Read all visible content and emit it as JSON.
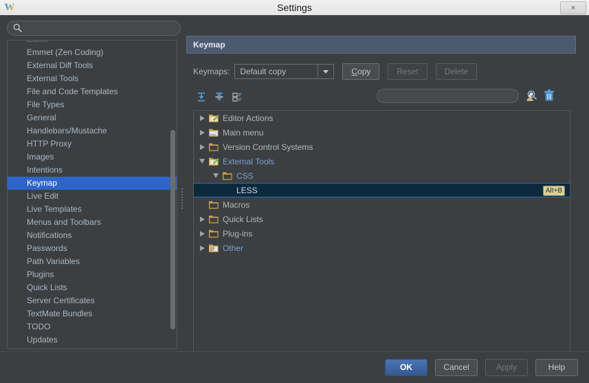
{
  "window": {
    "title": "Settings",
    "app_icon": "webstorm-logo-icon",
    "close_label": "×"
  },
  "sidebar": {
    "search": {
      "value": "",
      "placeholder": ""
    },
    "clipped_top_item": "Editor",
    "items": [
      {
        "label": "Emmet (Zen Coding)",
        "selected": false
      },
      {
        "label": "External Diff Tools",
        "selected": false
      },
      {
        "label": "External Tools",
        "selected": false
      },
      {
        "label": "File and Code Templates",
        "selected": false
      },
      {
        "label": "File Types",
        "selected": false
      },
      {
        "label": "General",
        "selected": false
      },
      {
        "label": "Handlebars/Mustache",
        "selected": false
      },
      {
        "label": "HTTP Proxy",
        "selected": false
      },
      {
        "label": "Images",
        "selected": false
      },
      {
        "label": "Intentions",
        "selected": false
      },
      {
        "label": "Keymap",
        "selected": true
      },
      {
        "label": "Live Edit",
        "selected": false
      },
      {
        "label": "Live Templates",
        "selected": false
      },
      {
        "label": "Menus and Toolbars",
        "selected": false
      },
      {
        "label": "Notifications",
        "selected": false
      },
      {
        "label": "Passwords",
        "selected": false
      },
      {
        "label": "Path Variables",
        "selected": false
      },
      {
        "label": "Plugins",
        "selected": false
      },
      {
        "label": "Quick Lists",
        "selected": false
      },
      {
        "label": "Server Certificates",
        "selected": false
      },
      {
        "label": "TextMate Bundles",
        "selected": false
      },
      {
        "label": "TODO",
        "selected": false
      },
      {
        "label": "Updates",
        "selected": false
      }
    ]
  },
  "panel": {
    "title": "Keymap",
    "keymaps_label": "Keymaps:",
    "keymap_selected": "Default copy",
    "buttons": {
      "copy": "Copy",
      "copy_mnemonic": "C",
      "copy_rest": "opy",
      "reset": "Reset",
      "delete": "Delete"
    },
    "toolbar": {
      "expand_all": "expand-all-icon",
      "collapse_all": "collapse-all-icon",
      "edit_shortcut": "edit-shortcut-icon",
      "search_value": "",
      "search_placeholder": "",
      "find_by_shortcut": "find-by-shortcut-icon",
      "clear": "trash-icon"
    }
  },
  "tree": {
    "nodes": [
      {
        "label": "Editor Actions",
        "indent": 0,
        "twist": "right",
        "icon": "folder-edit-icon",
        "style": "normal",
        "selected": false,
        "shortcut": ""
      },
      {
        "label": "Main menu",
        "indent": 0,
        "twist": "right",
        "icon": "folder-menu-icon",
        "style": "normal",
        "selected": false,
        "shortcut": ""
      },
      {
        "label": "Version Control Systems",
        "indent": 0,
        "twist": "right",
        "icon": "folder-icon",
        "style": "normal",
        "selected": false,
        "shortcut": ""
      },
      {
        "label": "External Tools",
        "indent": 0,
        "twist": "down",
        "icon": "folder-edit-icon",
        "style": "blue",
        "selected": false,
        "shortcut": ""
      },
      {
        "label": "CSS",
        "indent": 1,
        "twist": "down",
        "icon": "folder-icon",
        "style": "blue",
        "selected": false,
        "shortcut": ""
      },
      {
        "label": "LESS",
        "indent": 2,
        "twist": "none",
        "icon": "none",
        "style": "selected",
        "selected": true,
        "shortcut": "Alt+B"
      },
      {
        "label": "Macros",
        "indent": 0,
        "twist": "none",
        "icon": "folder-icon",
        "style": "normal",
        "selected": false,
        "shortcut": ""
      },
      {
        "label": "Quick Lists",
        "indent": 0,
        "twist": "right",
        "icon": "folder-icon",
        "style": "normal",
        "selected": false,
        "shortcut": ""
      },
      {
        "label": "Plug-ins",
        "indent": 0,
        "twist": "right",
        "icon": "folder-icon",
        "style": "normal",
        "selected": false,
        "shortcut": ""
      },
      {
        "label": "Other",
        "indent": 0,
        "twist": "right",
        "icon": "folder-other-icon",
        "style": "blue",
        "selected": false,
        "shortcut": ""
      }
    ]
  },
  "footer": {
    "ok": "OK",
    "cancel": "Cancel",
    "apply": "Apply",
    "help": "Help"
  },
  "colors": {
    "window_bg": "#3c3f41",
    "selection_blue": "#2f65ca",
    "panel_header": "#4c5a70",
    "tree_selection": "#0d293e",
    "tree_selection_border": "#2d6ea8",
    "badge_bg": "#d6d2a0",
    "link_blue": "#7a9fd4",
    "primary_button": "#3d639f"
  }
}
